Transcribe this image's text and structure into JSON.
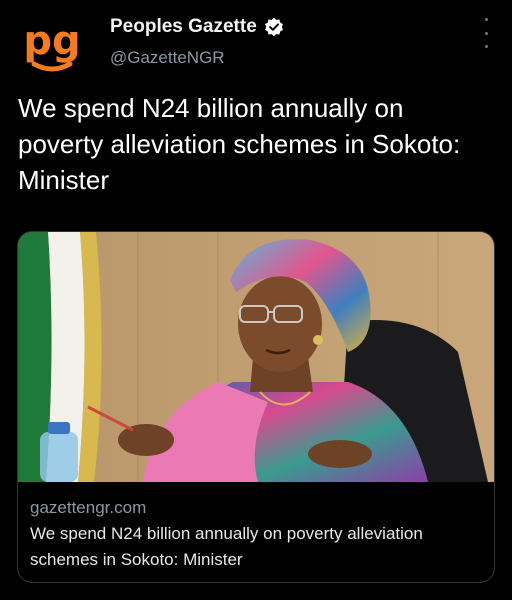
{
  "author": {
    "display_name": "Peoples Gazette",
    "handle": "@GazetteNGR",
    "avatar_text": "pg",
    "verified": true
  },
  "tweet": {
    "text": "We spend N24 billion annually on poverty alleviation schemes in Sokoto: Minister"
  },
  "card": {
    "domain": "gazettengr.com",
    "title": "We spend N24 billion annually on poverty alleviation schemes in Sokoto: Minister"
  },
  "icons": {
    "verified": "verified-badge-icon",
    "more": "more-options-icon"
  },
  "colors": {
    "background": "#000000",
    "logo_orange": "#f47b20",
    "muted_text": "#8b98a5"
  }
}
